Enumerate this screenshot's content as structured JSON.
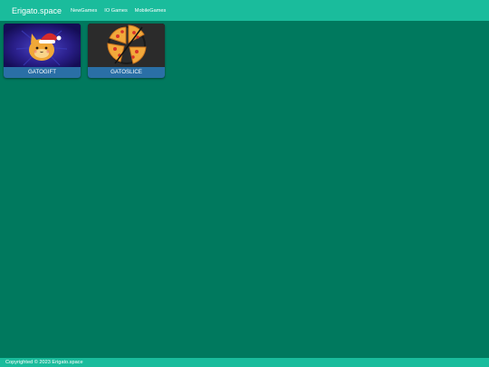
{
  "navbar": {
    "brand": "Erigato.space",
    "links": [
      "NewGames",
      "IO Games",
      "MobileGames"
    ]
  },
  "games": [
    {
      "title": "GATOGIFT",
      "thumbnail": "cat-with-santa-hat"
    },
    {
      "title": "GATOSLICE",
      "thumbnail": "sliced-pizza"
    }
  ],
  "footer": {
    "text": "Copyrighted © 2023 Erigato.space"
  },
  "colors": {
    "navbar": "#1abc9c",
    "background": "#00795e",
    "card_label": "#2a6fa6",
    "footer": "#1abc9c"
  }
}
